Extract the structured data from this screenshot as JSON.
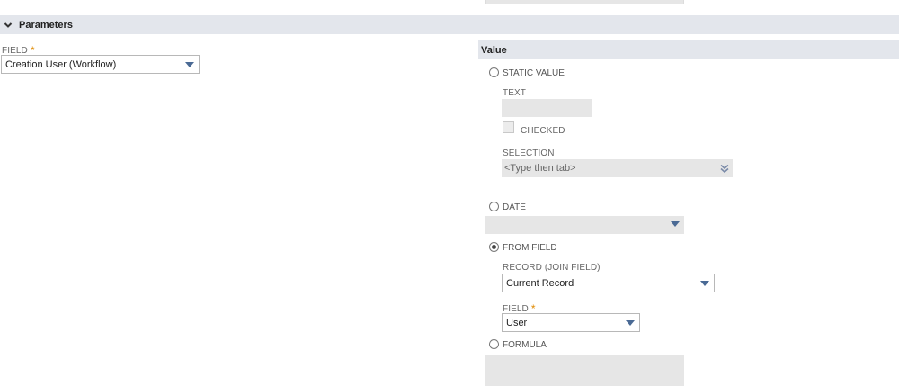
{
  "section": {
    "title": "Parameters"
  },
  "left": {
    "field_label": "FIELD",
    "required_mark": "*",
    "field_value": "Creation User (Workflow)"
  },
  "value_panel": {
    "header": "Value",
    "options": {
      "static_value": "STATIC VALUE",
      "date": "DATE",
      "from_field": "FROM FIELD",
      "formula": "FORMULA"
    },
    "selected_option": "FROM FIELD",
    "static": {
      "text_label": "TEXT",
      "checked_label": "CHECKED",
      "selection_label": "SELECTION",
      "selection_placeholder": "<Type then tab>"
    },
    "from_field": {
      "record_label": "RECORD (JOIN FIELD)",
      "record_value": "Current Record",
      "field_label": "FIELD",
      "required_mark": "*",
      "field_value": "User"
    }
  },
  "colors": {
    "header_bg": "#e3e6ec",
    "disabled_bg": "#e6e6e6",
    "caret": "#4a6a95",
    "required": "#e08a00"
  },
  "icons": [
    "chevron-down-icon",
    "dropdown-caret-icon",
    "double-chevron-down-icon",
    "radio-icon",
    "checkbox-icon"
  ]
}
